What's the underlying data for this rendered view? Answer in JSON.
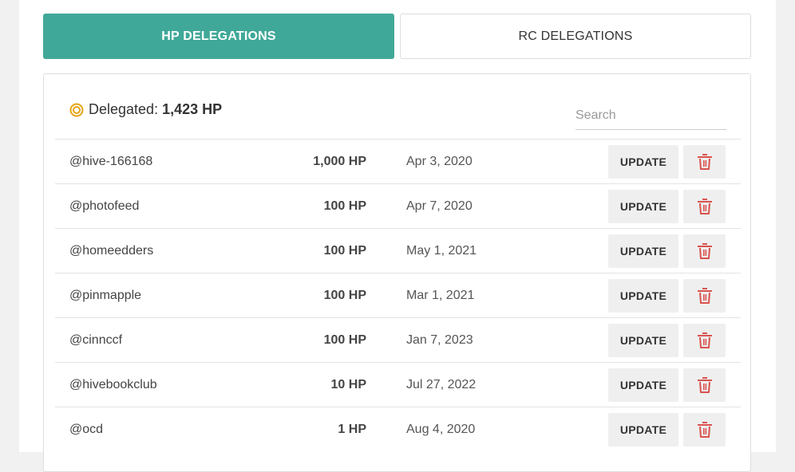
{
  "tabs": {
    "hp_label": "HP DELEGATIONS",
    "rc_label": "RC DELEGATIONS",
    "active": "hp"
  },
  "summary": {
    "label": "Delegated:",
    "value": "1,423 HP",
    "icon": "coin-icon"
  },
  "search": {
    "placeholder": "Search",
    "value": ""
  },
  "colors": {
    "accent": "#40a898",
    "coin": "#e8a317",
    "danger": "#d9534f",
    "button_bg": "#efefef"
  },
  "delegations": [
    {
      "user": "@hive-166168",
      "amount": "1,000 HP",
      "date": "Apr 3, 2020"
    },
    {
      "user": "@photofeed",
      "amount": "100 HP",
      "date": "Apr 7, 2020"
    },
    {
      "user": "@homeedders",
      "amount": "100 HP",
      "date": "May 1, 2021"
    },
    {
      "user": "@pinmapple",
      "amount": "100 HP",
      "date": "Mar 1, 2021"
    },
    {
      "user": "@cinnccf",
      "amount": "100 HP",
      "date": "Jan 7, 2023"
    },
    {
      "user": "@hivebookclub",
      "amount": "10 HP",
      "date": "Jul 27, 2022"
    },
    {
      "user": "@ocd",
      "amount": "1 HP",
      "date": "Aug 4, 2020"
    }
  ],
  "row_actions": {
    "update_label": "UPDATE",
    "delete_icon": "trash-icon"
  }
}
